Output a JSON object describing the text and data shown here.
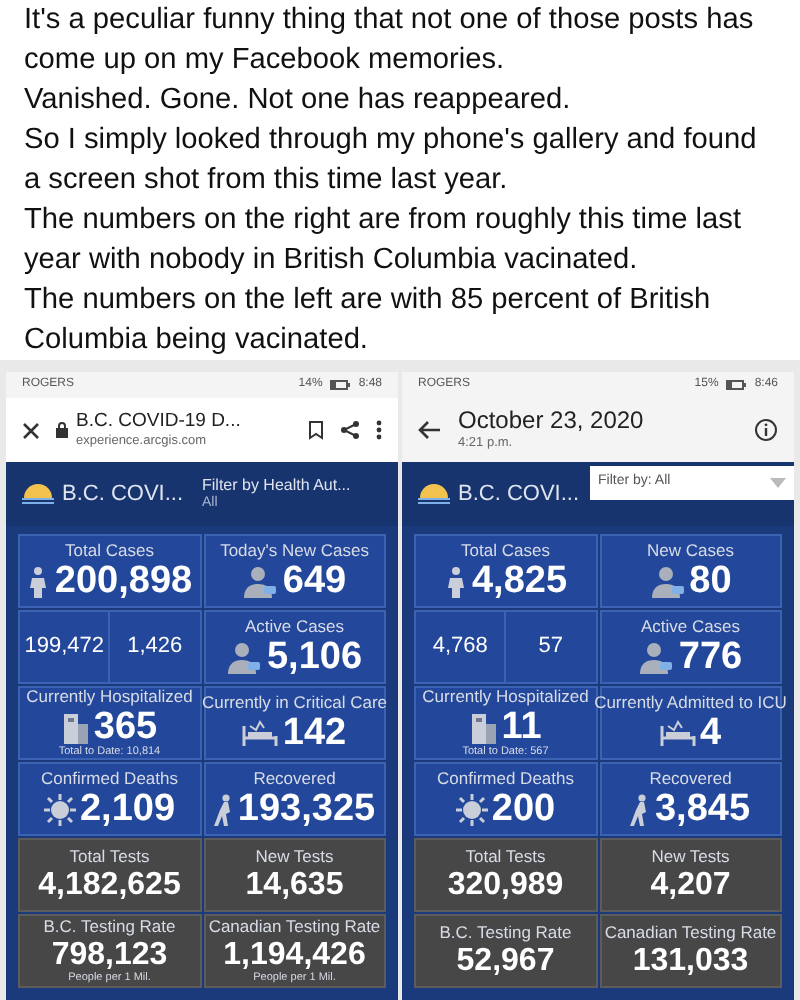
{
  "post": {
    "paragraphs": [
      "It's a peculiar funny thing that not one of those posts has come up on my Facebook memories.",
      "Vanished. Gone. Not one has reappeared.",
      "So I simply looked through my phone's gallery and found a screen shot from this time last year.",
      "The numbers on the right are from roughly this time last year with nobody in British Columbia vacinated.",
      "The numbers on the left are with 85 percent of British Columbia being vacinated."
    ]
  },
  "screenshots": [
    {
      "status_bar": {
        "carrier": "ROGERS",
        "battery": "14%",
        "time": "8:48"
      },
      "header": {
        "kind": "browser",
        "title": "B.C. COVID-19 D...",
        "url": "experience.arcgis.com"
      },
      "dashboard": {
        "title": "B.C. COVI...",
        "filter": {
          "kind": "label",
          "label": "Filter by Health Aut...",
          "value": "All"
        },
        "tiles": [
          {
            "kind": "stat",
            "label": "Total Cases",
            "value": "200,898"
          },
          {
            "kind": "stat",
            "label": "Today's New Cases",
            "value": "649"
          },
          {
            "kind": "split",
            "values": [
              "199,472",
              "1,426"
            ]
          },
          {
            "kind": "stat",
            "label": "Active Cases",
            "value": "5,106"
          },
          {
            "kind": "stat",
            "label": "Currently Hospitalized",
            "value": "365",
            "note": "Total to Date: 10,814"
          },
          {
            "kind": "stat",
            "label": "Currently in Critical Care",
            "value": "142"
          },
          {
            "kind": "stat",
            "label": "Confirmed Deaths",
            "value": "2,109"
          },
          {
            "kind": "stat",
            "label": "Recovered",
            "value": "193,325"
          },
          {
            "kind": "test",
            "label": "Total Tests",
            "value": "4,182,625"
          },
          {
            "kind": "test",
            "label": "New Tests",
            "value": "14,635"
          },
          {
            "kind": "test",
            "label": "B.C. Testing Rate",
            "value": "798,123",
            "note": "People per 1 Mil."
          },
          {
            "kind": "test",
            "label": "Canadian Testing Rate",
            "value": "1,194,426",
            "note": "People per 1 Mil."
          }
        ]
      }
    },
    {
      "status_bar": {
        "carrier": "ROGERS",
        "battery": "15%",
        "time": "8:46"
      },
      "header": {
        "kind": "gallery",
        "title": "October 23, 2020",
        "subtitle": "4:21 p.m."
      },
      "dashboard": {
        "title": "B.C. COVI...",
        "filter": {
          "kind": "dropdown",
          "label": "Filter by: All"
        },
        "tiles": [
          {
            "kind": "stat",
            "label": "Total Cases",
            "value": "4,825"
          },
          {
            "kind": "stat",
            "label": "New Cases",
            "value": "80"
          },
          {
            "kind": "split",
            "values": [
              "4,768",
              "57"
            ]
          },
          {
            "kind": "stat",
            "label": "Active Cases",
            "value": "776"
          },
          {
            "kind": "stat",
            "label": "Currently Hospitalized",
            "value": "11",
            "note": "Total to Date: 567"
          },
          {
            "kind": "stat",
            "label": "Currently Admitted to ICU",
            "value": "4"
          },
          {
            "kind": "stat",
            "label": "Confirmed Deaths",
            "value": "200"
          },
          {
            "kind": "stat",
            "label": "Recovered",
            "value": "3,845"
          },
          {
            "kind": "test",
            "label": "Total Tests",
            "value": "320,989"
          },
          {
            "kind": "test",
            "label": "New Tests",
            "value": "4,207"
          },
          {
            "kind": "test",
            "label": "B.C. Testing Rate",
            "value": "52,967"
          },
          {
            "kind": "test",
            "label": "Canadian Testing Rate",
            "value": "131,033"
          }
        ]
      }
    }
  ]
}
